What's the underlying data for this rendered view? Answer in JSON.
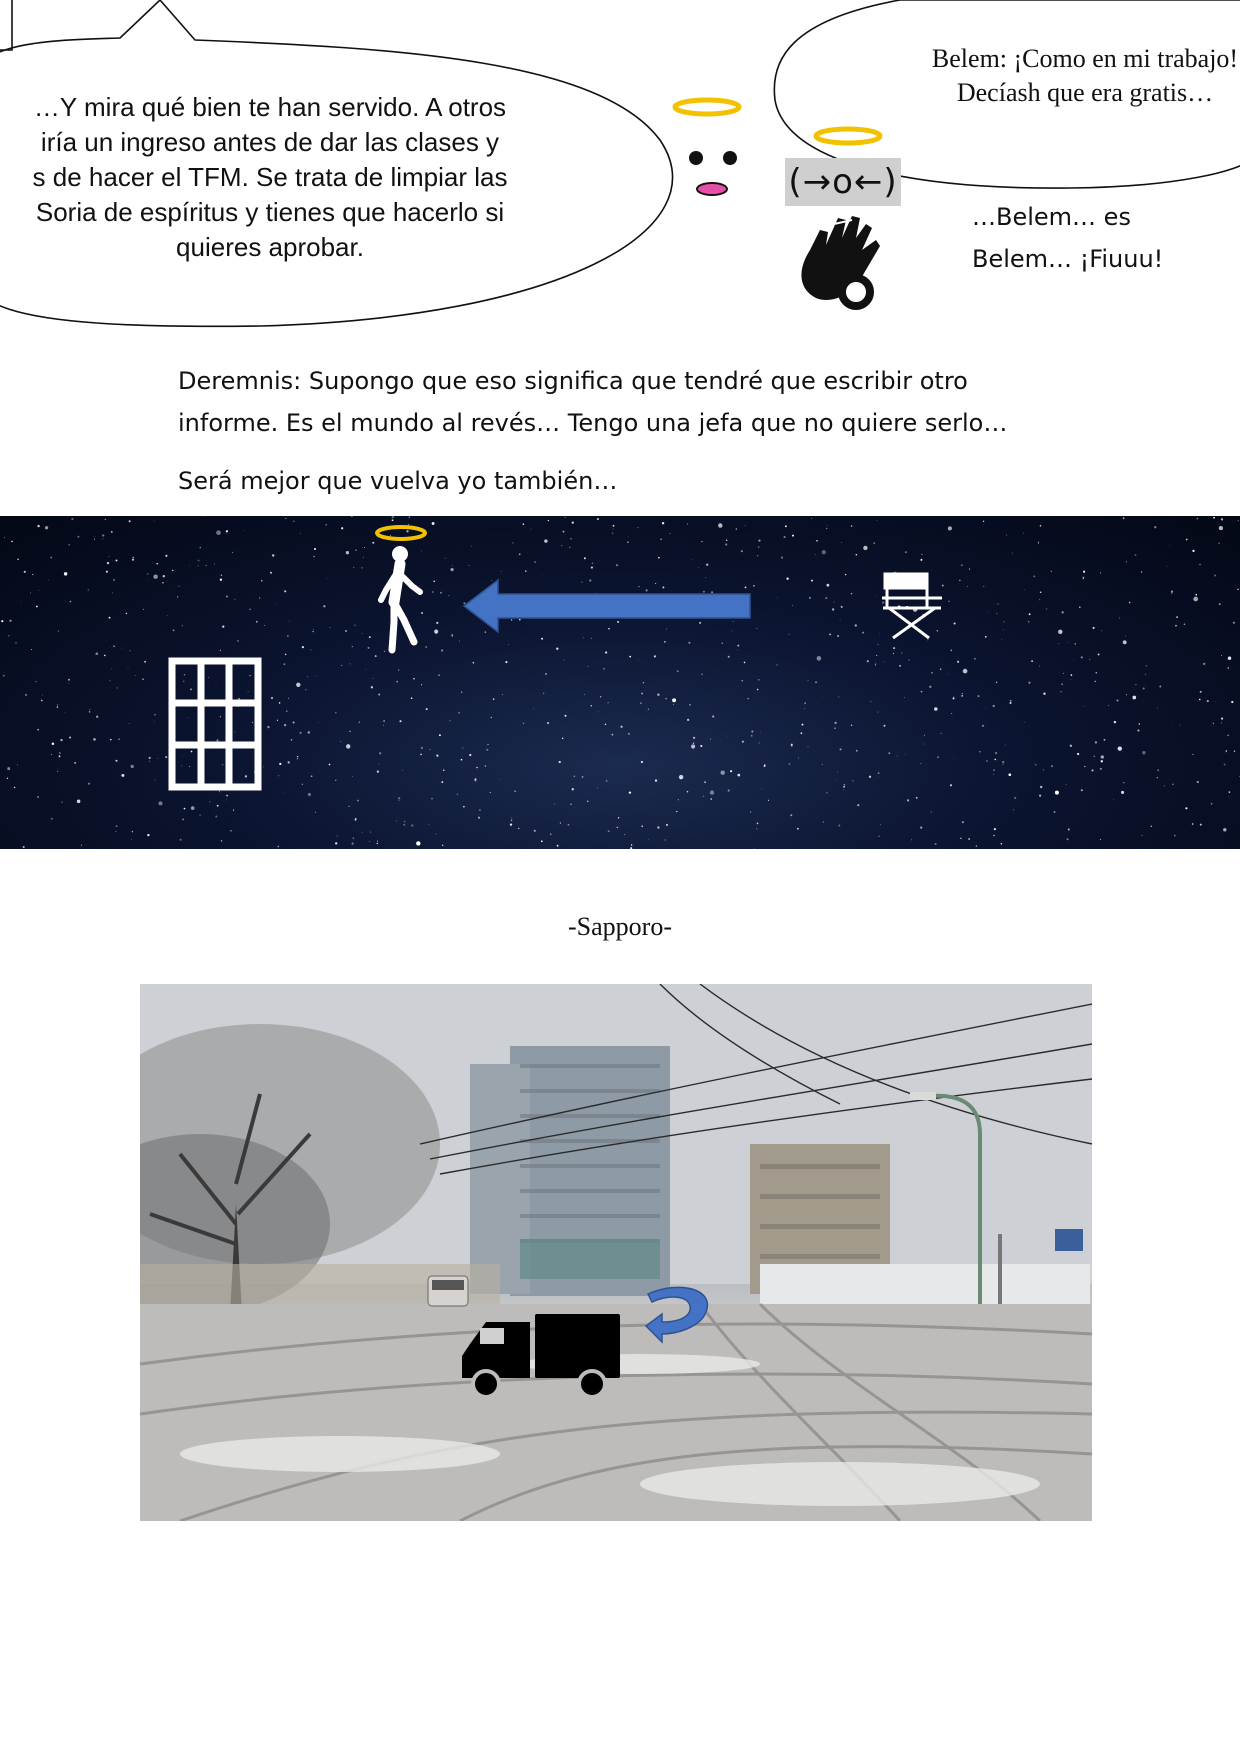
{
  "bubble_left": {
    "lines": [
      "…Y mira qué bien te han servido. A otros",
      "iría un ingreso antes de dar las clases y",
      "s de hacer el TFM. Se trata de limpiar las",
      "Soria de espíritus y tienes que hacerlo si",
      "quieres aprobar."
    ]
  },
  "bubble_right": {
    "lines": [
      "Belem: ¡Como en mi trabajo!",
      "Decíash que era gratis…"
    ]
  },
  "kaomoji": "(→o←)",
  "aside": {
    "lines": [
      "…Belem… es",
      "Belem… ¡Fiuuu!"
    ]
  },
  "narrative": {
    "line1": "Deremnis: Supongo que eso significa que tendré que escribir otro",
    "line2": "informe. Es el mundo al revés… Tengo una jefa que no quiere serlo…",
    "line3": "Será mejor que vuelva yo también…"
  },
  "caption": "-Sapporo-",
  "colors": {
    "halo": "#f2c200",
    "arrow": "#4472c4",
    "blush": "#e64fa6"
  },
  "icons": [
    "halo-icon",
    "face-icon",
    "clapping-hands-icon",
    "walking-person-icon",
    "arrow-left-icon",
    "directors-chair-icon",
    "window-icon",
    "truck-icon",
    "u-turn-arrow-icon"
  ]
}
